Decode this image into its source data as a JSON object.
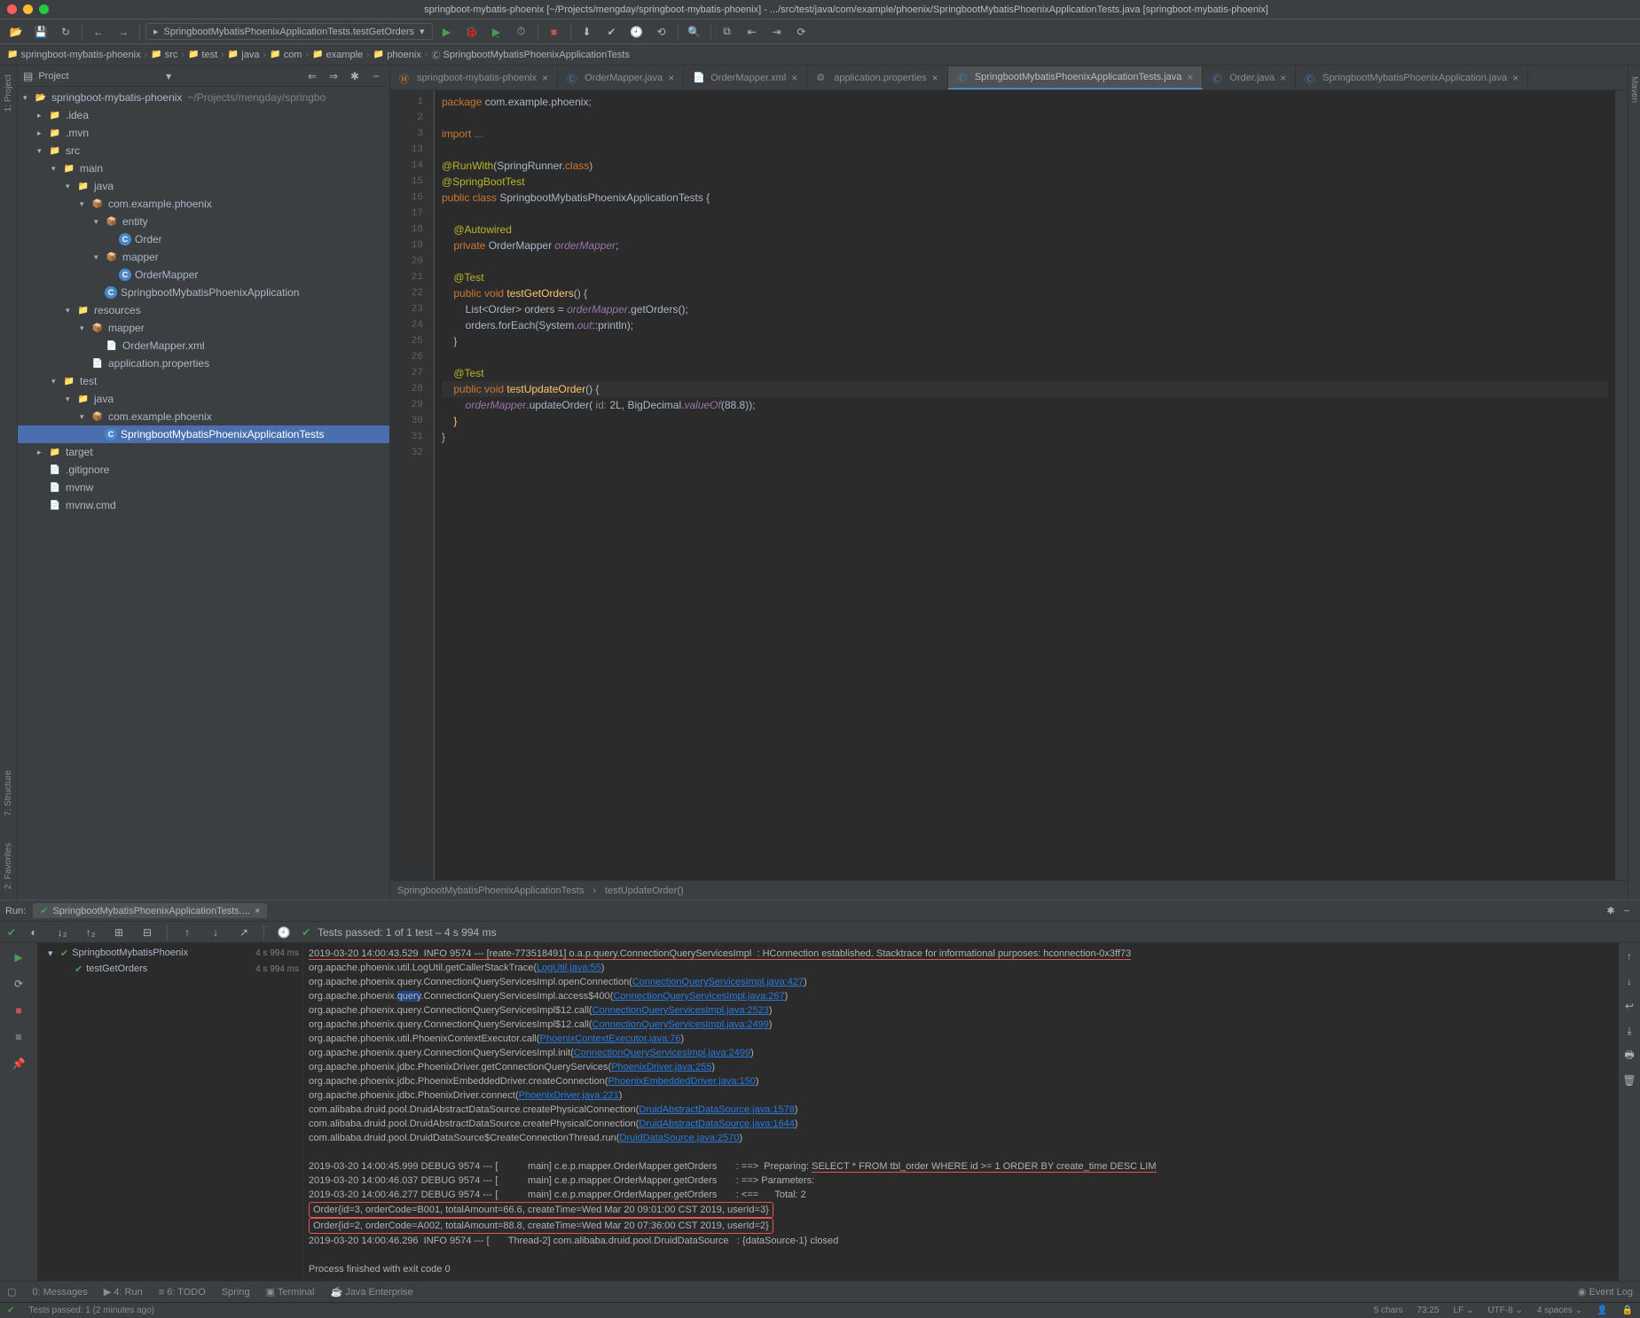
{
  "title": "springboot-mybatis-phoenix [~/Projects/mengday/springboot-mybatis-phoenix] - .../src/test/java/com/example/phoenix/SpringbootMybatisPhoenixApplicationTests.java [springboot-mybatis-phoenix]",
  "run_config": "SpringbootMybatisPhoenixApplicationTests.testGetOrders",
  "breadcrumb": [
    "springboot-mybatis-phoenix",
    "src",
    "test",
    "java",
    "com",
    "example",
    "phoenix",
    "SpringbootMybatisPhoenixApplicationTests"
  ],
  "panel": {
    "title": "Project"
  },
  "tree": [
    {
      "d": 0,
      "type": "proj",
      "exp": 1,
      "label": "springboot-mybatis-phoenix",
      "hint": "~/Projects/mengday/springbo"
    },
    {
      "d": 1,
      "type": "dir",
      "exp": 0,
      "label": ".idea"
    },
    {
      "d": 1,
      "type": "dir",
      "exp": 0,
      "label": ".mvn"
    },
    {
      "d": 1,
      "type": "dir",
      "exp": 1,
      "label": "src"
    },
    {
      "d": 2,
      "type": "dir",
      "exp": 1,
      "label": "main"
    },
    {
      "d": 3,
      "type": "dir",
      "exp": 1,
      "label": "java"
    },
    {
      "d": 4,
      "type": "pkg",
      "exp": 1,
      "label": "com.example.phoenix"
    },
    {
      "d": 5,
      "type": "pkg",
      "exp": 1,
      "label": "entity"
    },
    {
      "d": 6,
      "type": "cls",
      "label": "Order"
    },
    {
      "d": 5,
      "type": "pkg",
      "exp": 1,
      "label": "mapper"
    },
    {
      "d": 6,
      "type": "cls",
      "label": "OrderMapper"
    },
    {
      "d": 5,
      "type": "cls",
      "label": "SpringbootMybatisPhoenixApplication"
    },
    {
      "d": 3,
      "type": "dir",
      "exp": 1,
      "label": "resources"
    },
    {
      "d": 4,
      "type": "pkg",
      "exp": 1,
      "label": "mapper"
    },
    {
      "d": 5,
      "type": "xml",
      "label": "OrderMapper.xml"
    },
    {
      "d": 4,
      "type": "file",
      "label": "application.properties"
    },
    {
      "d": 2,
      "type": "dir",
      "exp": 1,
      "label": "test"
    },
    {
      "d": 3,
      "type": "dir",
      "exp": 1,
      "label": "java"
    },
    {
      "d": 4,
      "type": "pkg",
      "exp": 1,
      "label": "com.example.phoenix"
    },
    {
      "d": 5,
      "type": "cls",
      "label": "SpringbootMybatisPhoenixApplicationTests",
      "sel": 1
    },
    {
      "d": 1,
      "type": "dir",
      "exp": 0,
      "label": "target"
    },
    {
      "d": 1,
      "type": "file",
      "label": ".gitignore"
    },
    {
      "d": 1,
      "type": "file",
      "label": "mvnw"
    },
    {
      "d": 1,
      "type": "file",
      "label": "mvnw.cmd"
    }
  ],
  "tabs": [
    {
      "label": "springboot-mybatis-phoenix",
      "ico": "m"
    },
    {
      "label": "OrderMapper.java",
      "ico": "c"
    },
    {
      "label": "OrderMapper.xml",
      "ico": "x"
    },
    {
      "label": "application.properties",
      "ico": "p"
    },
    {
      "label": "SpringbootMybatisPhoenixApplicationTests.java",
      "ico": "c",
      "active": 1
    },
    {
      "label": "Order.java",
      "ico": "c"
    },
    {
      "label": "SpringbootMybatisPhoenixApplication.java",
      "ico": "c"
    }
  ],
  "code_lines": [
    1,
    2,
    3,
    13,
    14,
    15,
    16,
    17,
    18,
    19,
    20,
    21,
    22,
    23,
    24,
    25,
    26,
    27,
    28,
    29,
    30,
    31,
    32
  ],
  "editor_breadcrumb": [
    "SpringbootMybatisPhoenixApplicationTests",
    "testUpdateOrder()"
  ],
  "run": {
    "tab": "SpringbootMybatisPhoenixApplicationTests....",
    "status": "Tests passed: 1 of 1 test – 4 s 994 ms",
    "tests": [
      {
        "label": "SpringbootMybatisPhoenix",
        "time": "4 s 994 ms"
      },
      {
        "label": "testGetOrders",
        "time": "4 s 994 ms",
        "child": 1
      }
    ],
    "console": [
      "2019-03-20 14:00:43.529  INFO 9574 --- [reate-773518491] o.a.p.query.ConnectionQueryServicesImpl  : HConnection established. Stacktrace for informational purposes: hconnection-0x3ff73",
      "org.apache.phoenix.util.LogUtil.getCallerStackTrace(LogUtil.java:55)",
      "org.apache.phoenix.query.ConnectionQueryServicesImpl.openConnection(ConnectionQueryServicesImpl.java:427)",
      "org.apache.phoenix.query.ConnectionQueryServicesImpl.access$400(ConnectionQueryServicesImpl.java:267)",
      "org.apache.phoenix.query.ConnectionQueryServicesImpl$12.call(ConnectionQueryServicesImpl.java:2523)",
      "org.apache.phoenix.query.ConnectionQueryServicesImpl$12.call(ConnectionQueryServicesImpl.java:2499)",
      "org.apache.phoenix.util.PhoenixContextExecutor.call(PhoenixContextExecutor.java:76)",
      "org.apache.phoenix.query.ConnectionQueryServicesImpl.init(ConnectionQueryServicesImpl.java:2499)",
      "org.apache.phoenix.jdbc.PhoenixDriver.getConnectionQueryServices(PhoenixDriver.java:255)",
      "org.apache.phoenix.jdbc.PhoenixEmbeddedDriver.createConnection(PhoenixEmbeddedDriver.java:150)",
      "org.apache.phoenix.jdbc.PhoenixDriver.connect(PhoenixDriver.java:221)",
      "com.alibaba.druid.pool.DruidAbstractDataSource.createPhysicalConnection(DruidAbstractDataSource.java:1578)",
      "com.alibaba.druid.pool.DruidAbstractDataSource.createPhysicalConnection(DruidAbstractDataSource.java:1644)",
      "com.alibaba.druid.pool.DruidDataSource$CreateConnectionThread.run(DruidDataSource.java:2570)",
      "",
      "2019-03-20 14:00:45.999 DEBUG 9574 --- [           main] c.e.p.mapper.OrderMapper.getOrders       : ==>  Preparing: SELECT * FROM tbl_order WHERE id >= 1 ORDER BY create_time DESC LIM",
      "2019-03-20 14:00:46.037 DEBUG 9574 --- [           main] c.e.p.mapper.OrderMapper.getOrders       : ==> Parameters: ",
      "2019-03-20 14:00:46.277 DEBUG 9574 --- [           main] c.e.p.mapper.OrderMapper.getOrders       : <==      Total: 2",
      "Order{id=3, orderCode=B001, totalAmount=66.6, createTime=Wed Mar 20 09:01:00 CST 2019, userId=3}",
      "Order{id=2, orderCode=A002, totalAmount=88.8, createTime=Wed Mar 20 07:36:00 CST 2019, userId=2}",
      "2019-03-20 14:00:46.296  INFO 9574 --- [       Thread-2] com.alibaba.druid.pool.DruidDataSource   : {dataSource-1} closed",
      "",
      "Process finished with exit code 0"
    ]
  },
  "bottom": {
    "messages": "0: Messages",
    "run": "4: Run",
    "todo": "6: TODO",
    "spring": "Spring",
    "terminal": "Terminal",
    "javaee": "Java Enterprise",
    "eventlog": "Event Log"
  },
  "status": {
    "msg": "Tests passed: 1 (2 minutes ago)",
    "chars": "5 chars",
    "pos": "73:25",
    "le": "LF",
    "enc": "UTF-8",
    "indent": "4 spaces"
  }
}
